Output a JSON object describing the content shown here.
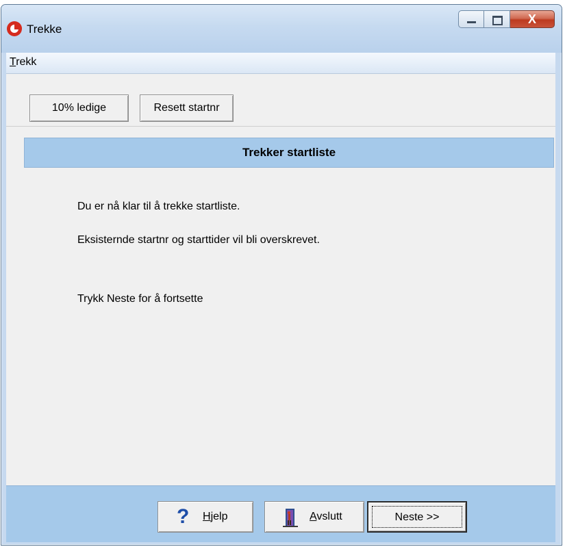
{
  "window": {
    "title": "Trekke",
    "icon": "app-logo-icon"
  },
  "caption_buttons": {
    "minimize_icon": "minimize-icon",
    "maximize_icon": "maximize-icon",
    "close_glyph": "X"
  },
  "menu": {
    "items": [
      {
        "label_accel": "T",
        "label_rest": "rekk"
      }
    ]
  },
  "toolbar": {
    "btn_ledige": "10% ledige",
    "btn_resett": "Resett startnr"
  },
  "panel": {
    "header": "Trekker startliste",
    "line1": "Du er nå klar til å trekke startliste.",
    "line2": "Eksisternde startnr og starttider vil bli overskrevet.",
    "line3": "Trykk Neste for å fortsette"
  },
  "footer": {
    "help_accel": "H",
    "help_rest": "jelp",
    "exit_accel": "A",
    "exit_rest": "vslutt",
    "next_label": "Neste >>"
  },
  "colors": {
    "panel_blue": "#a5c9ea",
    "window_frame": "#c6d9ef",
    "close_red": "#c8533a"
  }
}
